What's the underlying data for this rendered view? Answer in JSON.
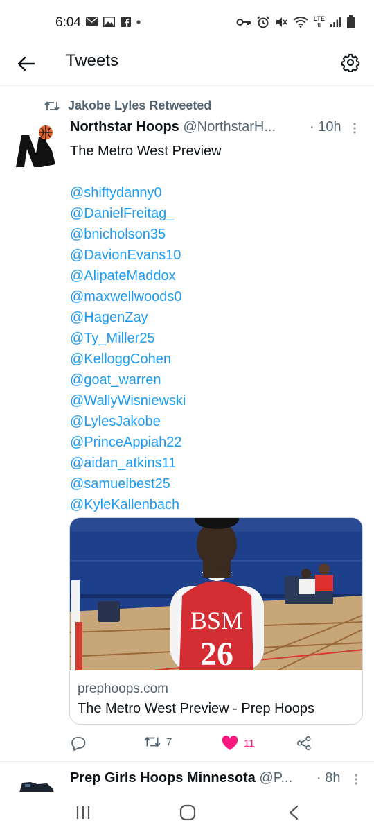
{
  "status_bar": {
    "time": "6:04",
    "left_icons": [
      "email-icon",
      "image-icon",
      "facebook-icon",
      "dot-icon"
    ],
    "right_icons": [
      "key-icon",
      "alarm-icon",
      "mute-icon",
      "wifi-icon",
      "lte-icon",
      "signal-icon",
      "battery-icon"
    ],
    "lte_label": "LTE"
  },
  "app_bar": {
    "title": "Tweets",
    "back_icon": "arrow-left-icon",
    "settings_icon": "gear-icon"
  },
  "tweet": {
    "retweeted_by": "Jakobe Lyles Retweeted",
    "display_name": "Northstar Hoops",
    "handle": "@NorthstarH...",
    "time": "· 10h",
    "text": "The Metro West Preview",
    "mentions": [
      "@shiftydanny0",
      "@DanielFreitag_",
      "@bnicholson35",
      "@DavionEvans10",
      "@AlipateMaddox",
      "@maxwellwoods0",
      "@HagenZay",
      "@Ty_Miller25",
      "@KelloggCohen",
      "@goat_warren",
      "@WallyWisniewski",
      "@LylesJakobe",
      "@PrinceAppiah22",
      "@aidan_atkins11",
      "@samuelbest25",
      "@KyleKallenbach"
    ],
    "card": {
      "image_text_top": "BSM",
      "image_text_number": "26",
      "domain": "prephoops.com",
      "title": "The Metro West Preview - Prep Hoops"
    },
    "actions": {
      "reply_count": "",
      "retweet_count": "7",
      "like_count": "11"
    }
  },
  "next_tweet": {
    "display_name": "Prep Girls Hoops Minnesota",
    "handle": "@P...",
    "time": "· 8h"
  },
  "colors": {
    "accent": "#1d9bf0",
    "like": "#f91880",
    "secondary_text": "#536471",
    "border": "#cfd9de"
  }
}
